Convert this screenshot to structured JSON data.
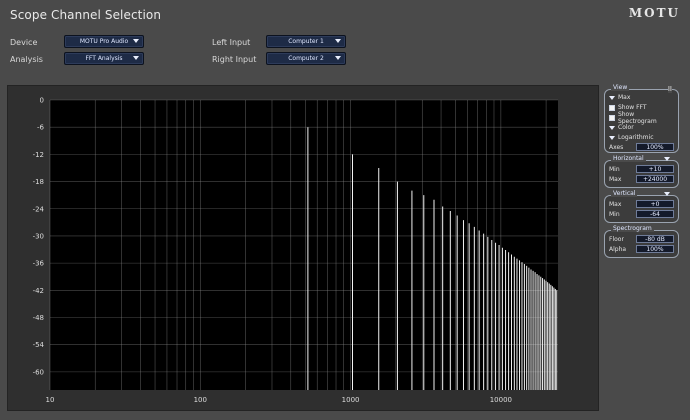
{
  "window": {
    "title": "Scope Channel Selection",
    "logo": "MOTU"
  },
  "controls": {
    "device": {
      "label": "Device",
      "value": "MOTU Pro Audio"
    },
    "analysis": {
      "label": "Analysis",
      "value": "FFT Analysis"
    },
    "left_input": {
      "label": "Left Input",
      "value": "Computer 1"
    },
    "right_input": {
      "label": "Right Input",
      "value": "Computer 2"
    }
  },
  "view_panel": {
    "title": "View",
    "top_button": "II",
    "items": [
      {
        "label": "Max",
        "kind": "triangle"
      },
      {
        "label": "Show FFT",
        "kind": "checkbox",
        "checked": false
      },
      {
        "label": "Show Spectrogram",
        "kind": "checkbox",
        "checked": false
      },
      {
        "label": "Color",
        "kind": "triangle"
      },
      {
        "label": "Logarithmic",
        "kind": "triangle"
      }
    ],
    "axes": {
      "label": "Axes",
      "value": "100%"
    }
  },
  "horizontal_panel": {
    "title": "Horizontal",
    "min": {
      "label": "Min",
      "value": "+10"
    },
    "max": {
      "label": "Max",
      "value": "+24000"
    }
  },
  "vertical_panel": {
    "title": "Vertical",
    "max": {
      "label": "Max",
      "value": "+0"
    },
    "min": {
      "label": "Min",
      "value": "-64"
    }
  },
  "spectrogram_panel": {
    "title": "Spectrogram",
    "floor": {
      "label": "Floor",
      "value": "-80 dB"
    },
    "alpha": {
      "label": "Alpha",
      "value": "100%"
    }
  },
  "colors": {
    "background": "#4a4a4a",
    "plot_bg": "#000000",
    "grid": "#8a8a8a",
    "trace": "#f2f2f2",
    "control_blue": "#1e2b46"
  },
  "chart_data": {
    "type": "bar",
    "xscale": "log",
    "xlim": [
      10,
      24000
    ],
    "ylim": [
      -64,
      0
    ],
    "y_ticks": [
      0,
      -6,
      -12,
      -18,
      -24,
      -30,
      -36,
      -42,
      -48,
      -54,
      -60
    ],
    "x_tick_labels": [
      {
        "value": 10,
        "label": "10"
      },
      {
        "value": 100,
        "label": "100"
      },
      {
        "value": 1000,
        "label": "1000"
      },
      {
        "value": 10000,
        "label": "10000"
      }
    ],
    "x_minor": [
      20,
      30,
      40,
      50,
      60,
      70,
      80,
      90,
      200,
      300,
      400,
      500,
      600,
      700,
      800,
      900,
      2000,
      3000,
      4000,
      5000,
      6000,
      7000,
      8000,
      9000,
      20000
    ],
    "floor": -64,
    "harmonics": [
      {
        "freq": 520,
        "level": -6
      },
      {
        "freq": 1030,
        "level": -12
      },
      {
        "freq": 1540,
        "level": -15
      },
      {
        "freq": 2050,
        "level": -18
      },
      {
        "freq": 2560,
        "level": -20
      },
      {
        "freq": 3070,
        "level": -21
      },
      {
        "freq": 3590,
        "level": -22
      },
      {
        "freq": 4100,
        "level": -23.5
      },
      {
        "freq": 4610,
        "level": -24.5
      },
      {
        "freq": 5120,
        "level": -25.5
      },
      {
        "freq": 5640,
        "level": -26.5
      },
      {
        "freq": 6150,
        "level": -27.2
      },
      {
        "freq": 6660,
        "level": -28
      },
      {
        "freq": 7170,
        "level": -28.8
      },
      {
        "freq": 7680,
        "level": -29.5
      },
      {
        "freq": 8190,
        "level": -30.2
      },
      {
        "freq": 8700,
        "level": -30.9
      },
      {
        "freq": 9220,
        "level": -31.5
      },
      {
        "freq": 9730,
        "level": -32
      },
      {
        "freq": 10240,
        "level": -32.6
      },
      {
        "freq": 10750,
        "level": -33.1
      },
      {
        "freq": 11260,
        "level": -33.6
      },
      {
        "freq": 11770,
        "level": -34.1
      },
      {
        "freq": 12290,
        "level": -34.6
      },
      {
        "freq": 12800,
        "level": -35
      },
      {
        "freq": 13310,
        "level": -35.4
      },
      {
        "freq": 13820,
        "level": -35.8
      },
      {
        "freq": 14340,
        "level": -36.2
      },
      {
        "freq": 14850,
        "level": -36.6
      },
      {
        "freq": 15360,
        "level": -37
      },
      {
        "freq": 15870,
        "level": -37.4
      },
      {
        "freq": 16380,
        "level": -37.7
      },
      {
        "freq": 16900,
        "level": -38
      },
      {
        "freq": 17410,
        "level": -38.4
      },
      {
        "freq": 17920,
        "level": -38.7
      },
      {
        "freq": 18430,
        "level": -39
      },
      {
        "freq": 18940,
        "level": -39.3
      },
      {
        "freq": 19460,
        "level": -39.6
      },
      {
        "freq": 19970,
        "level": -39.9
      },
      {
        "freq": 20480,
        "level": -40.2
      },
      {
        "freq": 20990,
        "level": -40.5
      },
      {
        "freq": 21500,
        "level": -40.8
      },
      {
        "freq": 22020,
        "level": -41.1
      },
      {
        "freq": 22530,
        "level": -41.4
      },
      {
        "freq": 23040,
        "level": -41.7
      },
      {
        "freq": 23550,
        "level": -42
      }
    ]
  }
}
